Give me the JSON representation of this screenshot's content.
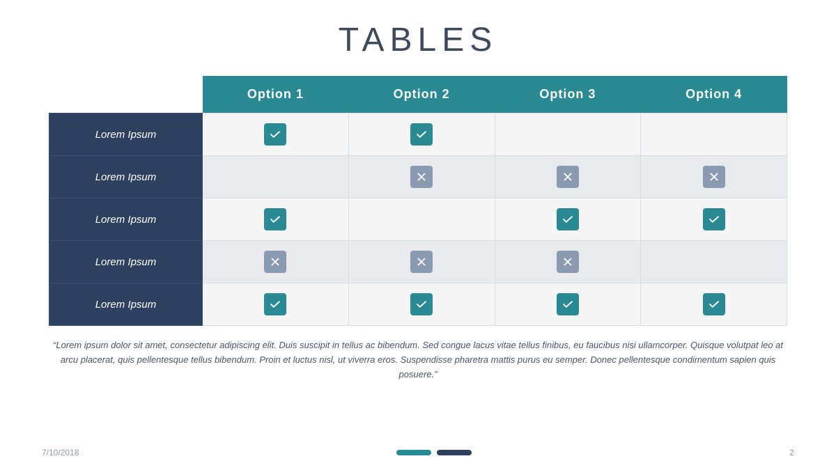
{
  "slide": {
    "title": "TABLES",
    "table": {
      "headers": [
        "",
        "Option 1",
        "Option 2",
        "Option 3",
        "Option 4"
      ],
      "rows": [
        {
          "label": "Lorem Ipsum",
          "cells": [
            "check",
            "check",
            "",
            ""
          ]
        },
        {
          "label": "Lorem Ipsum",
          "cells": [
            "",
            "cross",
            "cross",
            "cross"
          ]
        },
        {
          "label": "Lorem Ipsum",
          "cells": [
            "check",
            "",
            "check",
            "check"
          ]
        },
        {
          "label": "Lorem Ipsum",
          "cells": [
            "cross",
            "cross",
            "cross",
            ""
          ]
        },
        {
          "label": "Lorem Ipsum",
          "cells": [
            "check",
            "check",
            "check",
            "check"
          ]
        }
      ]
    },
    "quote": "“Lorem ipsum dolor sit amet, consectetur adipiscing elit. Duis suscipit in tellus ac bibendum. Sed congue lacus vitae tellus finibus, eu faucibus\nnisi ullamcorper. Quisque volutpat leo at arcu placerat,  quis pellentesque tellus bibendum. Proin et luctus nisl, ut viverra eros. Suspendisse\npharetra mattis purus eu semper. Donec pellentesque condimentum sapien quis posuere.”",
    "footer": {
      "date": "7/10/2018",
      "page": "2"
    }
  }
}
